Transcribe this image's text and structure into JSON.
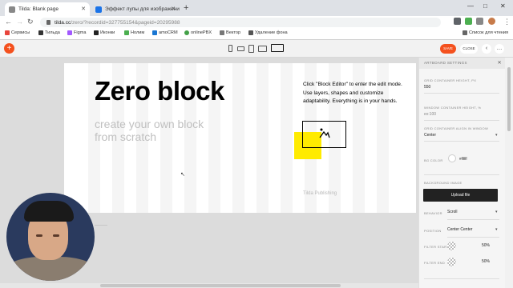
{
  "browser": {
    "tabs": [
      {
        "title": "Tilda: Blank page",
        "active": true,
        "favicon_color": "#888888"
      },
      {
        "title": "Эффект лупы для изображени",
        "active": false,
        "favicon_color": "#1a73e8"
      }
    ],
    "url_host": "tilda.cc",
    "url_path": "/zero/?recordid=327755154&pageid=20295988",
    "bookmarks": [
      {
        "label": "Сервисы",
        "color": "#e8453c"
      },
      {
        "label": "Тильда",
        "color": "#333333"
      },
      {
        "label": "Figma",
        "color": "#a259ff"
      },
      {
        "label": "Иконки",
        "color": "#222222"
      },
      {
        "label": "Нолим",
        "color": "#4caf50"
      },
      {
        "label": "amoCRM",
        "color": "#1976d2"
      },
      {
        "label": "onlinePBX",
        "color": "#43a047"
      },
      {
        "label": "Вектор",
        "color": "#777777"
      },
      {
        "label": "Удаление фона",
        "color": "#555555"
      },
      {
        "label": "Список для чтения",
        "color": "#666666"
      }
    ]
  },
  "toolbar": {
    "add_label": "+",
    "save_label": "SAVE",
    "close_label": "CLOSE",
    "back_label": "‹",
    "more_label": "…"
  },
  "canvas": {
    "title": "Zero block",
    "subtitle": "create your own block from scratch",
    "help_text": "Click \"Block Editor\" to enter the edit mode. Use layers, shapes and customize adaptability. Everything is in your hands.",
    "publisher": "Tilda Publishing",
    "tiny_label": "————"
  },
  "panel": {
    "header": "ARTBOARD SETTINGS",
    "grid_height_label": "GRID CONTAINER HEIGHT, PX",
    "grid_height_value": "550",
    "window_height_label": "WINDOW CONTAINER HEIGHT, %",
    "window_height_value": "ex:100",
    "align_label": "GRID CONTAINER ALIGN IN WINDOW",
    "align_value": "Center",
    "bgcolor_label": "BG COLOR",
    "bgcolor_value": "#ffffff",
    "bgimage_label": "BACKGROUND IMAGE",
    "upload_label": "Upload file",
    "behavior_label": "BEHAVIOR",
    "behavior_value": "Scroll",
    "position_label": "POSITION",
    "position_value": "Center Center",
    "filter_start_label": "FILTER START",
    "filter_start_value": "50%",
    "filter_end_label": "FILTER END",
    "filter_end_value": "50%"
  },
  "colors": {
    "accent": "#f4511e",
    "highlight": "#ffeb00"
  }
}
